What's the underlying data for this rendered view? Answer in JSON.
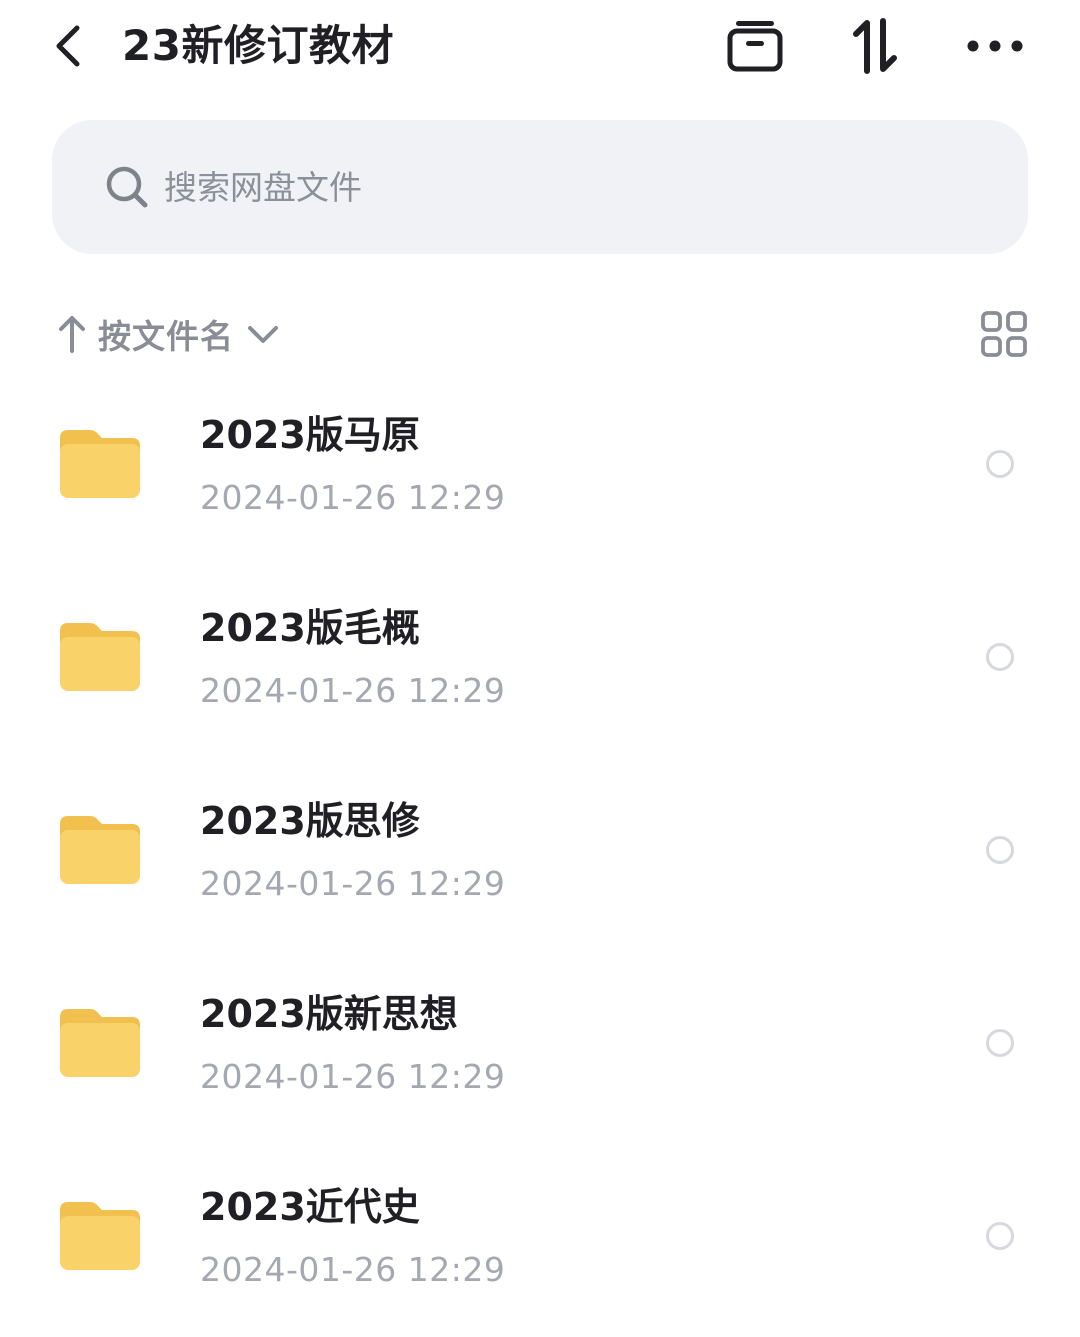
{
  "header": {
    "title": "23新修订教材",
    "icons": [
      "back-icon",
      "archive-icon",
      "sort-icon",
      "more-icon"
    ]
  },
  "search": {
    "placeholder": "搜索网盘文件",
    "value": ""
  },
  "sort": {
    "label": "按文件名",
    "direction": "ascending"
  },
  "colors": {
    "folder": "#f9d36a",
    "folder_tab": "#f2c04f",
    "search_bg": "#f0f2f6",
    "muted_text": "#a5a8b0"
  },
  "files": [
    {
      "name": "2023版马原",
      "date": "2024-01-26  12:29"
    },
    {
      "name": "2023版毛概",
      "date": "2024-01-26  12:29"
    },
    {
      "name": "2023版思修",
      "date": "2024-01-26  12:29"
    },
    {
      "name": "2023版新思想",
      "date": "2024-01-26  12:29"
    },
    {
      "name": "2023近代史",
      "date": "2024-01-26  12:29"
    }
  ]
}
